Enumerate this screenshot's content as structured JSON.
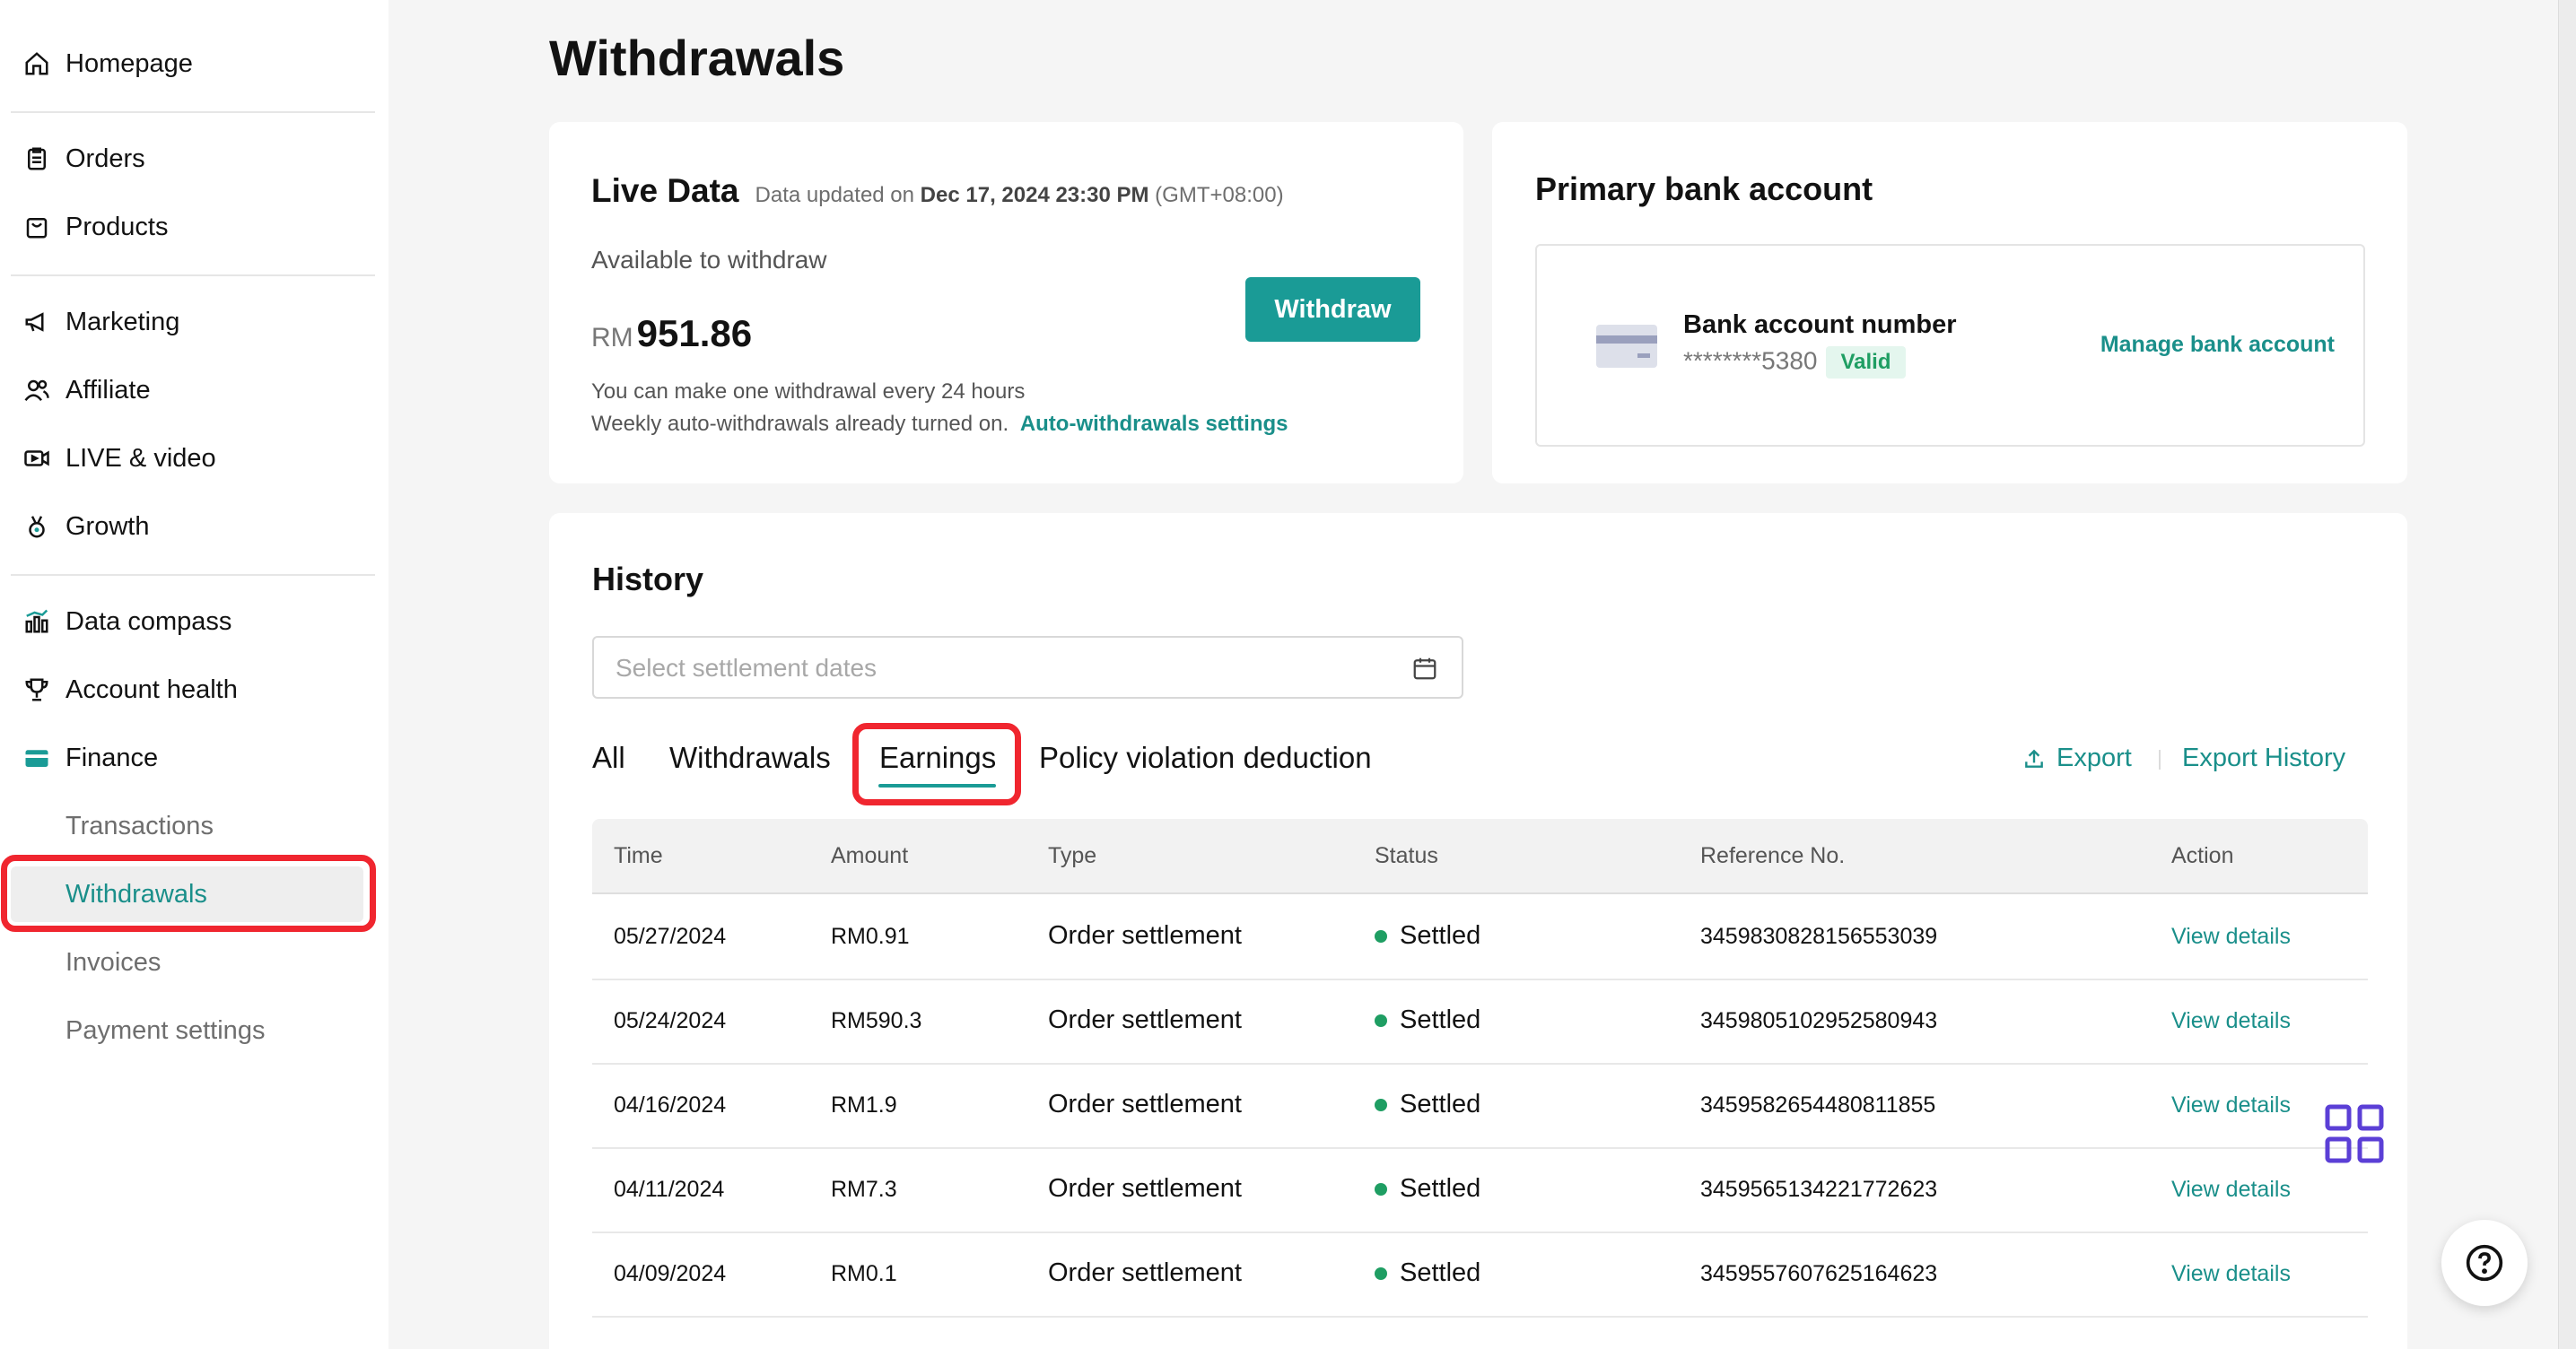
{
  "sidebar": {
    "items": [
      {
        "label": "Homepage",
        "icon": "home-icon"
      },
      {
        "label": "Orders",
        "icon": "clipboard-icon"
      },
      {
        "label": "Products",
        "icon": "bag-icon"
      },
      {
        "label": "Marketing",
        "icon": "megaphone-icon"
      },
      {
        "label": "Affiliate",
        "icon": "people-icon"
      },
      {
        "label": "LIVE & video",
        "icon": "video-icon"
      },
      {
        "label": "Growth",
        "icon": "medal-icon"
      },
      {
        "label": "Data compass",
        "icon": "bar-chart-icon"
      },
      {
        "label": "Account health",
        "icon": "trophy-icon"
      },
      {
        "label": "Finance",
        "icon": "wallet-icon"
      }
    ],
    "finance_sub": [
      "Transactions",
      "Withdrawals",
      "Invoices",
      "Payment settings"
    ],
    "active": "Withdrawals"
  },
  "page": {
    "title": "Withdrawals"
  },
  "live_data": {
    "title": "Live Data",
    "updated_prefix": "Data updated on ",
    "updated_date": "Dec 17, 2024 23:30 PM",
    "updated_tz": " (GMT+08:00)",
    "available_label": "Available to withdraw",
    "currency": "RM",
    "amount": "951.86",
    "withdraw_button": "Withdraw",
    "note_1": "You can make one withdrawal every 24 hours",
    "note_2": "Weekly auto-withdrawals already turned on.",
    "auto_link": "Auto-withdrawals settings"
  },
  "bank": {
    "title": "Primary bank account",
    "account_label": "Bank account number",
    "account_masked": "********5380",
    "badge": "Valid",
    "manage_link": "Manage bank account"
  },
  "history": {
    "title": "History",
    "date_placeholder": "Select settlement dates",
    "tabs": [
      "All",
      "Withdrawals",
      "Earnings",
      "Policy violation deduction"
    ],
    "active_tab": "Earnings",
    "export_label": "Export",
    "export_history_label": "Export History",
    "columns": [
      "Time",
      "Amount",
      "Type",
      "Status",
      "Reference No.",
      "Action"
    ],
    "rows": [
      {
        "time": "05/27/2024",
        "amount": "RM0.91",
        "type": "Order settlement",
        "status": "Settled",
        "ref": "3459830828156553039",
        "action": "View details"
      },
      {
        "time": "05/24/2024",
        "amount": "RM590.3",
        "type": "Order settlement",
        "status": "Settled",
        "ref": "3459805102952580943",
        "action": "View details"
      },
      {
        "time": "04/16/2024",
        "amount": "RM1.9",
        "type": "Order settlement",
        "status": "Settled",
        "ref": "3459582654480811855",
        "action": "View details"
      },
      {
        "time": "04/11/2024",
        "amount": "RM7.3",
        "type": "Order settlement",
        "status": "Settled",
        "ref": "3459565134221772623",
        "action": "View details"
      },
      {
        "time": "04/09/2024",
        "amount": "RM0.1",
        "type": "Order settlement",
        "status": "Settled",
        "ref": "3459557607625164623",
        "action": "View details"
      }
    ]
  },
  "colors": {
    "accent": "#1a9b96",
    "highlight": "#f0262f",
    "status_settled": "#1f9e63",
    "grid_widget": "#5b3fd6"
  }
}
